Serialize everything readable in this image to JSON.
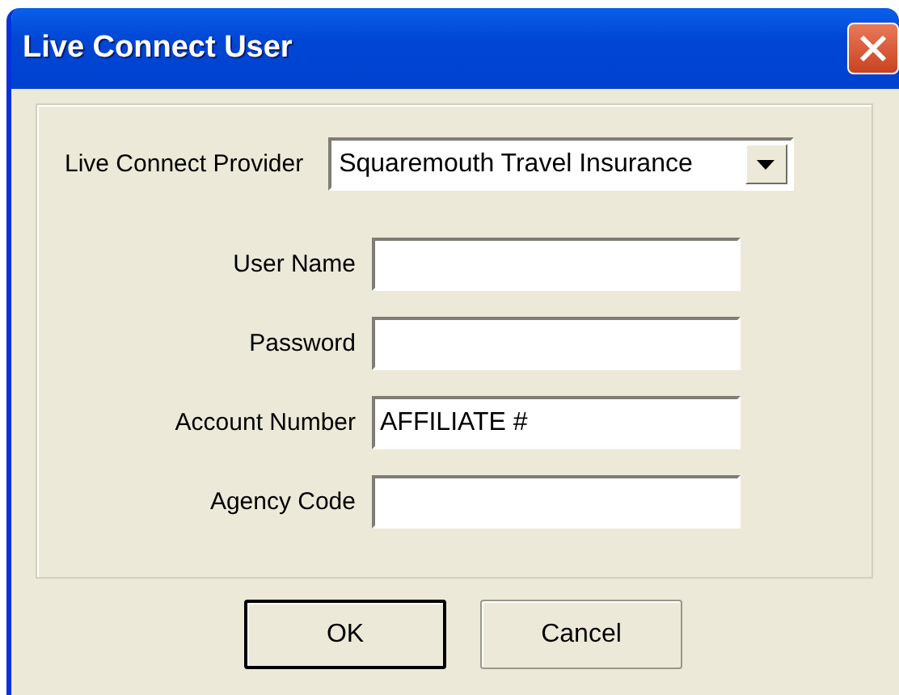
{
  "window": {
    "title": "Live Connect User"
  },
  "provider": {
    "label": "Live Connect Provider",
    "value": "Squaremouth Travel Insurance"
  },
  "fields": [
    {
      "label": "User Name"
    },
    {
      "label": "Password"
    },
    {
      "label": "Account Number",
      "value": "AFFILIATE #"
    },
    {
      "label": "Agency Code"
    }
  ],
  "buttons": [
    {
      "label": "OK",
      "default": true
    },
    {
      "label": "Cancel",
      "default": false
    }
  ]
}
